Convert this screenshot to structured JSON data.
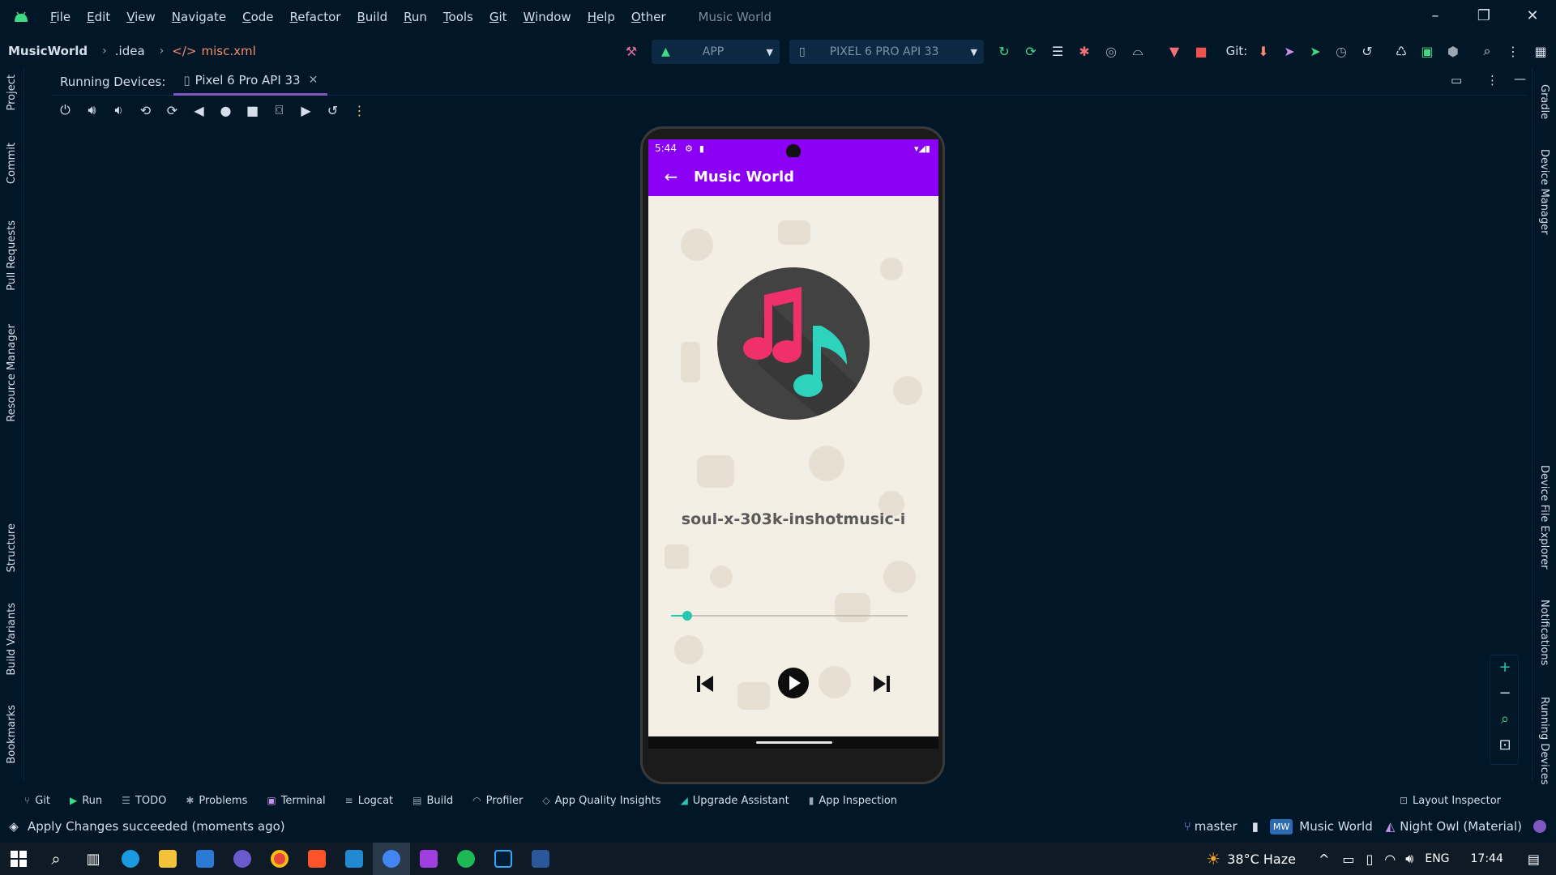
{
  "menu": {
    "items": [
      "File",
      "Edit",
      "View",
      "Navigate",
      "Code",
      "Refactor",
      "Build",
      "Run",
      "Tools",
      "Git",
      "Window",
      "Help",
      "Other"
    ],
    "window_title": "Music World"
  },
  "nav": {
    "project": "MusicWorld",
    "crumb_folder": ".idea",
    "crumb_file": "misc.xml",
    "run_config": "APP",
    "device": "PIXEL 6 PRO API 33",
    "git_label": "Git:"
  },
  "left_tools": [
    "Project",
    "Commit",
    "Pull Requests",
    "Resource Manager",
    "Structure",
    "Build Variants",
    "Bookmarks"
  ],
  "right_tools": [
    "Gradle",
    "Device Manager",
    "Device File Explorer",
    "Notifications",
    "Running Devices"
  ],
  "panel": {
    "title": "Running Devices:",
    "device_tab": "Pixel 6 Pro API 33"
  },
  "phone": {
    "time": "5:44",
    "app_title": "Music World",
    "song_name": "soul-x-303k-inshotmusic-i",
    "seek_progress": 0.07
  },
  "bottom_tools": [
    "Git",
    "Run",
    "TODO",
    "Problems",
    "Terminal",
    "Logcat",
    "Build",
    "Profiler",
    "App Quality Insights",
    "Upgrade Assistant",
    "App Inspection"
  ],
  "layout_inspector": "Layout Inspector",
  "status": {
    "message": "Apply Changes succeeded (moments ago)",
    "branch": "master",
    "project_badge": "MW",
    "project_name": "Music World",
    "theme": "Night Owl (Material)"
  },
  "taskbar": {
    "weather": "38°C  Haze",
    "lang": "ENG",
    "time": "17:44"
  },
  "colors": {
    "ide_bg": "#011627",
    "app_purple": "#8b00f4",
    "accent_teal": "#26c6b0",
    "note_pink": "#f0306a"
  }
}
